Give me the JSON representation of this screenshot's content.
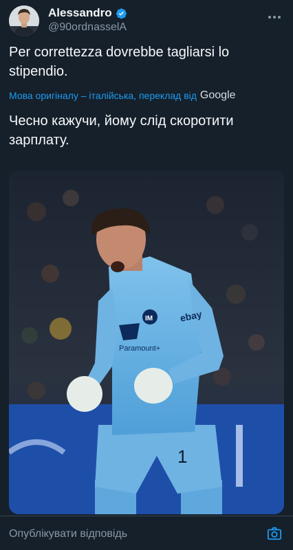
{
  "author": {
    "display_name": "Alessandro",
    "handle": "@90ordnasselA",
    "verified": true
  },
  "tweet": {
    "original_text": "Per correttezza dovrebbe tagliarsi lo stipendio.",
    "translation_note": "Мова оригіналу – італійська, переклад від",
    "translation_provider": "Google",
    "translated_text": "Чесно кажучи, йому слід скоротити зарплату."
  },
  "media": {
    "jersey_sponsor": "ebay",
    "jersey_text": "Paramount+",
    "shirt_number": "1"
  },
  "reply": {
    "placeholder": "Опублікувати відповідь"
  },
  "colors": {
    "background": "#15202b",
    "accent": "#1d9bf0",
    "text_primary": "#f7f9f9",
    "text_secondary": "#8b98a5"
  },
  "icons": {
    "verified": "verified-badge-icon",
    "more": "more-options-icon",
    "camera": "camera-icon"
  }
}
